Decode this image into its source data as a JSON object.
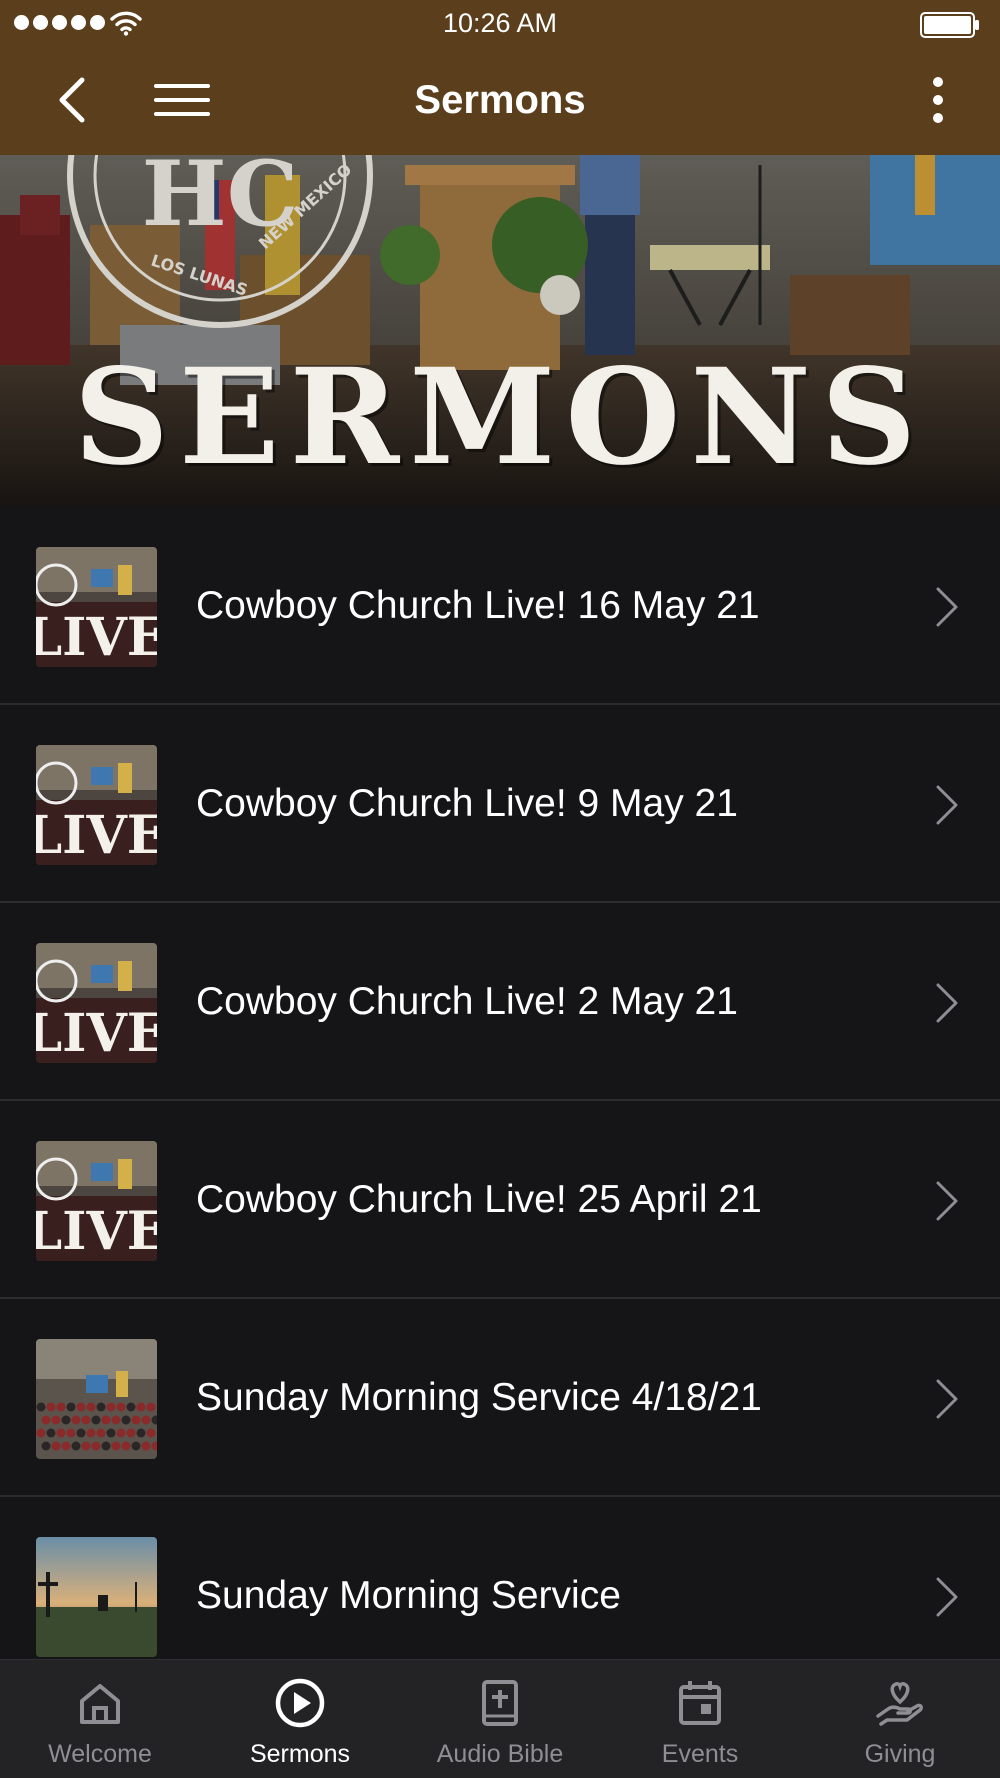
{
  "status_bar": {
    "time": "10:26 AM",
    "signal_icon": "signal-dots-icon",
    "wifi_icon": "wifi-icon",
    "battery_icon": "battery-icon",
    "battery_level": 1.0
  },
  "nav": {
    "title": "Sermons",
    "back_icon": "chevron-left-icon",
    "menu_icon": "hamburger-menu-icon",
    "more_icon": "more-vertical-icon"
  },
  "hero": {
    "title": "SERMONS",
    "seal_text": "LOS LUNAS NEW MEXICO",
    "seal_initials": "HC"
  },
  "sermons": {
    "items": [
      {
        "title": "Cowboy Church Live! 16 May 21",
        "thumb": "live",
        "thumb_text": "LIVE"
      },
      {
        "title": "Cowboy Church Live! 9 May 21",
        "thumb": "live",
        "thumb_text": "LIVE"
      },
      {
        "title": "Cowboy Church Live! 2 May 21",
        "thumb": "live",
        "thumb_text": "LIVE"
      },
      {
        "title": "Cowboy Church Live! 25 April 21",
        "thumb": "live",
        "thumb_text": "LIVE"
      },
      {
        "title": "Sunday Morning Service 4/18/21",
        "thumb": "congregation"
      },
      {
        "title": "Sunday Morning Service",
        "thumb": "sunset-cross"
      }
    ]
  },
  "tabbar": {
    "tabs": [
      {
        "label": "Welcome",
        "icon": "home-icon",
        "active": false
      },
      {
        "label": "Sermons",
        "icon": "play-circle-icon",
        "active": true
      },
      {
        "label": "Audio Bible",
        "icon": "bible-icon",
        "active": false
      },
      {
        "label": "Events",
        "icon": "calendar-icon",
        "active": false
      },
      {
        "label": "Giving",
        "icon": "giving-hand-icon",
        "active": false
      }
    ]
  },
  "colors": {
    "header_bg": "#5b3e1b",
    "list_bg": "#151518",
    "tabbar_bg": "#232326",
    "active_tab": "#ffffff",
    "inactive_tab": "#8e8e93"
  }
}
